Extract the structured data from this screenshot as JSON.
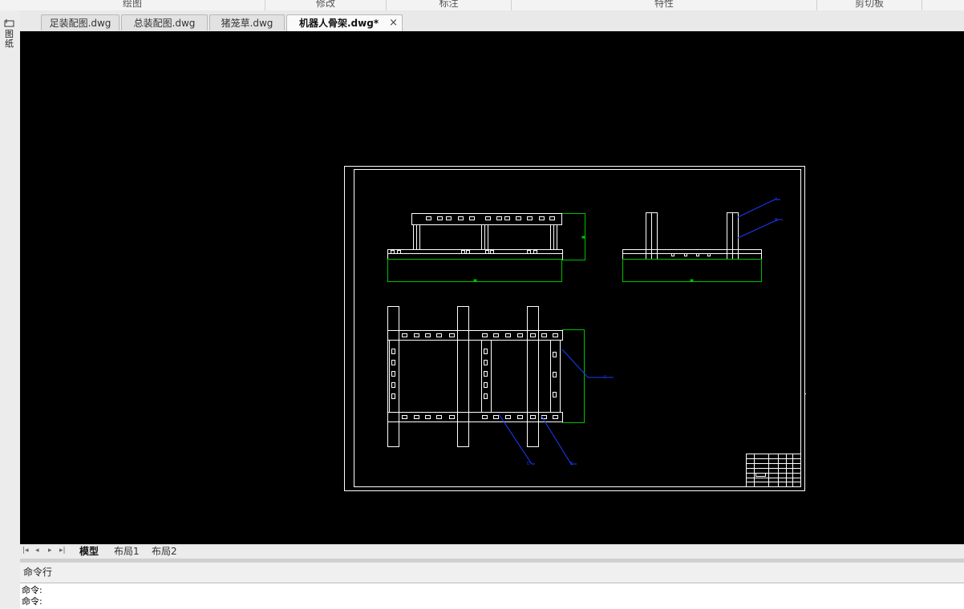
{
  "ribbon": {
    "groups": [
      "绘图",
      "修改",
      "标注",
      "特性",
      "剪切板"
    ]
  },
  "left_panel": {
    "label": "图纸"
  },
  "doc_tabs": [
    {
      "label": "足装配图.dwg"
    },
    {
      "label": "总装配图.dwg"
    },
    {
      "label": "猪笼草.dwg"
    },
    {
      "label": "机器人骨架.dwg*",
      "active": true
    }
  ],
  "close_glyph": "×",
  "layout_tabs": {
    "nav": [
      "|◂",
      "◂",
      "▸",
      "▸|"
    ],
    "items": [
      {
        "label": "模型",
        "active": true
      },
      {
        "label": "布局1"
      },
      {
        "label": "布局2"
      }
    ]
  },
  "command": {
    "header": "命令行",
    "lines": [
      "命令:",
      "命令:"
    ]
  },
  "drawing": {
    "background": "#000000",
    "line_color": "#ffffff",
    "dimension_color": "#00c000",
    "leader_color": "#1a3cff",
    "leader_labels": [
      "A",
      "B",
      "C",
      "D",
      "E"
    ]
  },
  "colors": {
    "tab_active_bg": "#fafafa",
    "tab_bg": "#e2e2e2",
    "chrome_bg": "#f0f0f0"
  }
}
